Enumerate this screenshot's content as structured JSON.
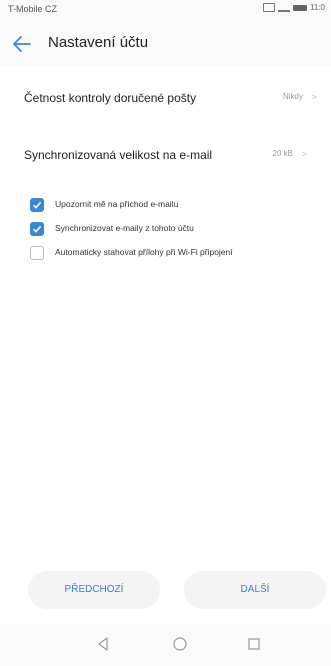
{
  "status_bar": {
    "carrier": "T-Mobile CZ",
    "time": "11:0",
    "accent_color": "#e4007c"
  },
  "header": {
    "title": "Nastavení účtu",
    "back_icon": "back-arrow-icon"
  },
  "settings": [
    {
      "label": "Četnost kontroly doručené pošty",
      "value": "Nikdy"
    },
    {
      "label": "Synchronizovaná velikost na e-mail",
      "value": "20 kB"
    }
  ],
  "checkboxes": [
    {
      "label": "Upozornit mě na příchod e-mailu",
      "checked": true
    },
    {
      "label": "Synchronizovat e-maily z tohoto účtu",
      "checked": true
    },
    {
      "label": "Automaticky stahovat přílohy při Wi-Fi připojení",
      "checked": false
    }
  ],
  "buttons": {
    "previous": "PŘEDCHOZÍ",
    "next": "DALŠÍ"
  },
  "nav_icons": [
    "back-triangle-icon",
    "home-circle-icon",
    "recents-square-icon"
  ],
  "colors": {
    "checkbox_accent": "#3b86d8",
    "button_text": "#3c7fd0"
  }
}
